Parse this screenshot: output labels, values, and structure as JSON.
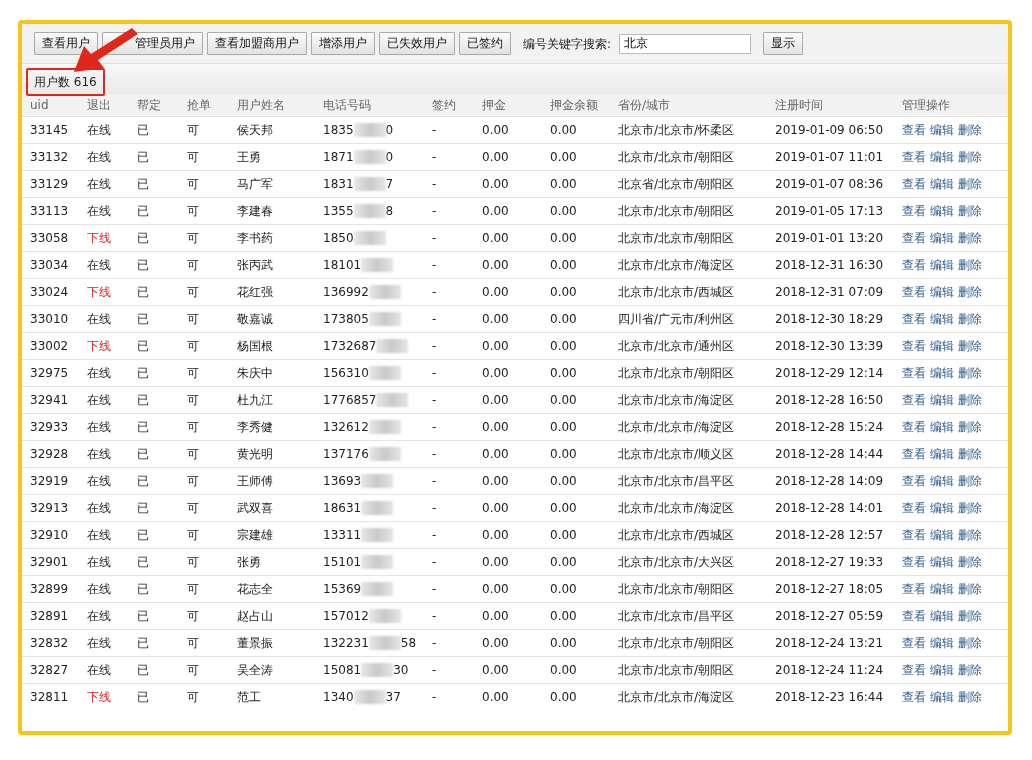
{
  "toolbar": {
    "buttons": [
      "查看用户",
      "管理员用户",
      "查看加盟商用户",
      "增添用户",
      "已失效用户",
      "已签约"
    ],
    "search_label": "编号关键字搜索:",
    "search_value": "北京",
    "show_button": "显示"
  },
  "user_count": {
    "text": "用户数 616",
    "highlighted": true
  },
  "table": {
    "columns": [
      "uid",
      "退出",
      "帮定",
      "抢单",
      "用户姓名",
      "电话号码",
      "签约",
      "押金",
      "押金余额",
      "省份/城市",
      "注册时间",
      "管理操作"
    ],
    "rows": [
      {
        "uid": "33145",
        "status": "在线",
        "offline": false,
        "bound": "已",
        "grab": "可",
        "name": "侯天邦",
        "phone_start": "1835",
        "phone_end": "0",
        "signed": "-",
        "deposit": "0.00",
        "balance": "0.00",
        "region": "北京市/北京市/怀柔区",
        "registered": "2019-01-09 06:50",
        "actions": [
          "查看",
          "编辑",
          "删除"
        ]
      },
      {
        "uid": "33132",
        "status": "在线",
        "offline": false,
        "bound": "已",
        "grab": "可",
        "name": "王勇",
        "phone_start": "1871",
        "phone_end": "0",
        "signed": "-",
        "deposit": "0.00",
        "balance": "0.00",
        "region": "北京市/北京市/朝阳区",
        "registered": "2019-01-07 11:01",
        "actions": [
          "查看",
          "编辑",
          "删除"
        ]
      },
      {
        "uid": "33129",
        "status": "在线",
        "offline": false,
        "bound": "已",
        "grab": "可",
        "name": "马广军",
        "phone_start": "1831",
        "phone_end": "7",
        "signed": "-",
        "deposit": "0.00",
        "balance": "0.00",
        "region": "北京省/北京市/朝阳区",
        "registered": "2019-01-07 08:36",
        "actions": [
          "查看",
          "编辑",
          "删除"
        ]
      },
      {
        "uid": "33113",
        "status": "在线",
        "offline": false,
        "bound": "已",
        "grab": "可",
        "name": "李建春",
        "phone_start": "1355",
        "phone_end": "8",
        "signed": "-",
        "deposit": "0.00",
        "balance": "0.00",
        "region": "北京市/北京市/朝阳区",
        "registered": "2019-01-05 17:13",
        "actions": [
          "查看",
          "编辑",
          "删除"
        ]
      },
      {
        "uid": "33058",
        "status": "下线",
        "offline": true,
        "bound": "已",
        "grab": "可",
        "name": "李书药",
        "phone_start": "1850",
        "signed": "-",
        "deposit": "0.00",
        "balance": "0.00",
        "region": "北京市/北京市/朝阳区",
        "registered": "2019-01-01 13:20",
        "actions": [
          "查看",
          "编辑",
          "删除"
        ]
      },
      {
        "uid": "33034",
        "status": "在线",
        "offline": false,
        "bound": "已",
        "grab": "可",
        "name": "张丙武",
        "phone_start": "18101",
        "signed": "-",
        "deposit": "0.00",
        "balance": "0.00",
        "region": "北京市/北京市/海淀区",
        "registered": "2018-12-31 16:30",
        "actions": [
          "查看",
          "编辑",
          "删除"
        ]
      },
      {
        "uid": "33024",
        "status": "下线",
        "offline": true,
        "bound": "已",
        "grab": "可",
        "name": "花红强",
        "phone_start": "136992",
        "signed": "-",
        "deposit": "0.00",
        "balance": "0.00",
        "region": "北京市/北京市/西城区",
        "registered": "2018-12-31 07:09",
        "actions": [
          "查看",
          "编辑",
          "删除"
        ]
      },
      {
        "uid": "33010",
        "status": "在线",
        "offline": false,
        "bound": "已",
        "grab": "可",
        "name": "敬嘉诚",
        "phone_start": "173805",
        "signed": "-",
        "deposit": "0.00",
        "balance": "0.00",
        "region": "四川省/广元市/利州区",
        "registered": "2018-12-30 18:29",
        "actions": [
          "查看",
          "编辑",
          "删除"
        ]
      },
      {
        "uid": "33002",
        "status": "下线",
        "offline": true,
        "bound": "已",
        "grab": "可",
        "name": "杨国根",
        "phone_start": "1732687",
        "signed": "-",
        "deposit": "0.00",
        "balance": "0.00",
        "region": "北京市/北京市/通州区",
        "registered": "2018-12-30 13:39",
        "actions": [
          "查看",
          "编辑",
          "删除"
        ]
      },
      {
        "uid": "32975",
        "status": "在线",
        "offline": false,
        "bound": "已",
        "grab": "可",
        "name": "朱庆中",
        "phone_start": "156310",
        "signed": "-",
        "deposit": "0.00",
        "balance": "0.00",
        "region": "北京市/北京市/朝阳区",
        "registered": "2018-12-29 12:14",
        "actions": [
          "查看",
          "编辑",
          "删除"
        ]
      },
      {
        "uid": "32941",
        "status": "在线",
        "offline": false,
        "bound": "已",
        "grab": "可",
        "name": "杜九江",
        "phone_start": "1776857",
        "signed": "-",
        "deposit": "0.00",
        "balance": "0.00",
        "region": "北京市/北京市/海淀区",
        "registered": "2018-12-28 16:50",
        "actions": [
          "查看",
          "编辑",
          "删除"
        ]
      },
      {
        "uid": "32933",
        "status": "在线",
        "offline": false,
        "bound": "已",
        "grab": "可",
        "name": "李秀健",
        "phone_start": "132612",
        "signed": "-",
        "deposit": "0.00",
        "balance": "0.00",
        "region": "北京市/北京市/海淀区",
        "registered": "2018-12-28 15:24",
        "actions": [
          "查看",
          "编辑",
          "删除"
        ]
      },
      {
        "uid": "32928",
        "status": "在线",
        "offline": false,
        "bound": "已",
        "grab": "可",
        "name": "黄光明",
        "phone_start": "137176",
        "signed": "-",
        "deposit": "0.00",
        "balance": "0.00",
        "region": "北京市/北京市/顺义区",
        "registered": "2018-12-28 14:44",
        "actions": [
          "查看",
          "编辑",
          "删除"
        ]
      },
      {
        "uid": "32919",
        "status": "在线",
        "offline": false,
        "bound": "已",
        "grab": "可",
        "name": "王师傅",
        "phone_start": "13693",
        "signed": "-",
        "deposit": "0.00",
        "balance": "0.00",
        "region": "北京市/北京市/昌平区",
        "registered": "2018-12-28 14:09",
        "actions": [
          "查看",
          "编辑",
          "删除"
        ]
      },
      {
        "uid": "32913",
        "status": "在线",
        "offline": false,
        "bound": "已",
        "grab": "可",
        "name": "武双喜",
        "phone_start": "18631",
        "signed": "-",
        "deposit": "0.00",
        "balance": "0.00",
        "region": "北京市/北京市/海淀区",
        "registered": "2018-12-28 14:01",
        "actions": [
          "查看",
          "编辑",
          "删除"
        ]
      },
      {
        "uid": "32910",
        "status": "在线",
        "offline": false,
        "bound": "已",
        "grab": "可",
        "name": "宗建雄",
        "phone_start": "13311",
        "signed": "-",
        "deposit": "0.00",
        "balance": "0.00",
        "region": "北京市/北京市/西城区",
        "registered": "2018-12-28 12:57",
        "actions": [
          "查看",
          "编辑",
          "删除"
        ]
      },
      {
        "uid": "32901",
        "status": "在线",
        "offline": false,
        "bound": "已",
        "grab": "可",
        "name": "张勇",
        "phone_start": "15101",
        "signed": "-",
        "deposit": "0.00",
        "balance": "0.00",
        "region": "北京市/北京市/大兴区",
        "registered": "2018-12-27 19:33",
        "actions": [
          "查看",
          "编辑",
          "删除"
        ]
      },
      {
        "uid": "32899",
        "status": "在线",
        "offline": false,
        "bound": "已",
        "grab": "可",
        "name": "花志全",
        "phone_start": "15369",
        "signed": "-",
        "deposit": "0.00",
        "balance": "0.00",
        "region": "北京市/北京市/朝阳区",
        "registered": "2018-12-27 18:05",
        "actions": [
          "查看",
          "编辑",
          "删除"
        ]
      },
      {
        "uid": "32891",
        "status": "在线",
        "offline": false,
        "bound": "已",
        "grab": "可",
        "name": "赵占山",
        "phone_start": "157012",
        "signed": "-",
        "deposit": "0.00",
        "balance": "0.00",
        "region": "北京市/北京市/昌平区",
        "registered": "2018-12-27 05:59",
        "actions": [
          "查看",
          "编辑",
          "删除"
        ]
      },
      {
        "uid": "32832",
        "status": "在线",
        "offline": false,
        "bound": "已",
        "grab": "可",
        "name": "董景振",
        "phone_start": "132231",
        "phone_end": "58",
        "signed": "-",
        "deposit": "0.00",
        "balance": "0.00",
        "region": "北京市/北京市/朝阳区",
        "registered": "2018-12-24 13:21",
        "actions": [
          "查看",
          "编辑",
          "删除"
        ]
      },
      {
        "uid": "32827",
        "status": "在线",
        "offline": false,
        "bound": "已",
        "grab": "可",
        "name": "吴全涛",
        "phone_start": "15081",
        "phone_end": "30",
        "signed": "-",
        "deposit": "0.00",
        "balance": "0.00",
        "region": "北京市/北京市/朝阳区",
        "registered": "2018-12-24 11:24",
        "actions": [
          "查看",
          "编辑",
          "删除"
        ]
      },
      {
        "uid": "32811",
        "status": "下线",
        "offline": true,
        "bound": "已",
        "grab": "可",
        "name": "范工",
        "phone_start": "1340",
        "phone_end": "37",
        "signed": "-",
        "deposit": "0.00",
        "balance": "0.00",
        "region": "北京市/北京市/海淀区",
        "registered": "2018-12-23 16:44",
        "actions": [
          "查看",
          "编辑",
          "删除"
        ]
      }
    ]
  }
}
